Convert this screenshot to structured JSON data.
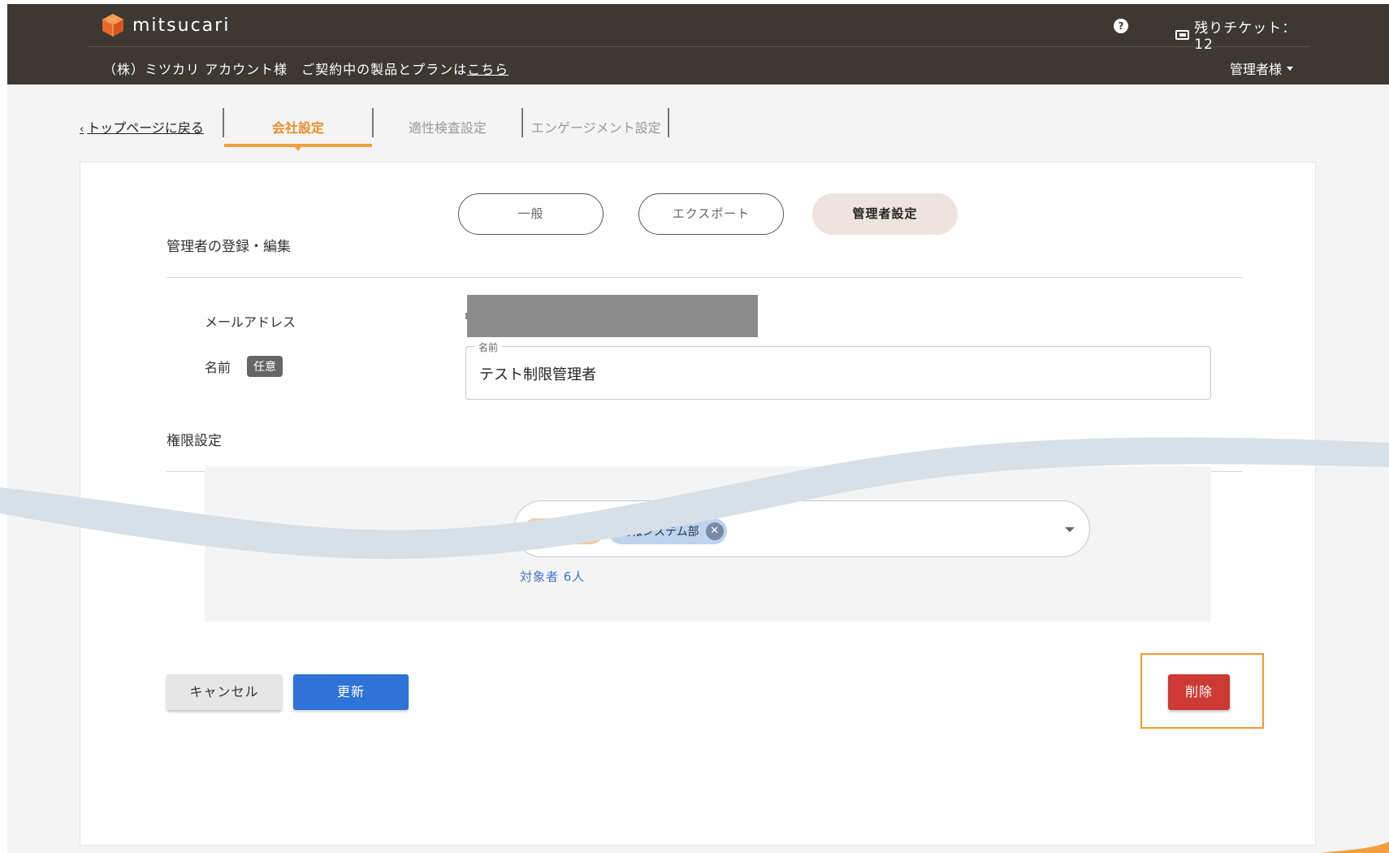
{
  "header": {
    "brand": "mitsucari",
    "ticket_label": "残りチケット：12",
    "help_glyph": "?",
    "company_prefix": "（株）ミツカリ アカウント様　ご契約中の製品とプランは",
    "company_link": "こちら",
    "admin_menu_label": "管理者様"
  },
  "tabs": {
    "back_label": "トップページに戻る",
    "company": "会社設定",
    "aptitude": "適性検査設定",
    "engagement": "エンゲージメント設定"
  },
  "subtabs": {
    "general": "一般",
    "export": "エクスポート",
    "admin": "管理者設定"
  },
  "form": {
    "section_title": "管理者の登録・編集",
    "email_label": "メールアドレス",
    "name_label": "名前",
    "optional_badge": "任意",
    "name_legend": "名前",
    "name_value": "テスト制限管理者"
  },
  "permissions": {
    "section_title": "権限設定",
    "chips": [
      "情報システム部"
    ],
    "target_count": "対象者 6人"
  },
  "buttons": {
    "cancel": "キャンセル",
    "update": "更新",
    "delete": "削除"
  },
  "colors": {
    "header_bg": "#3d3833",
    "accent_orange": "#f0a040",
    "primary_blue": "#2f73d8",
    "danger_red": "#cc3a33"
  }
}
